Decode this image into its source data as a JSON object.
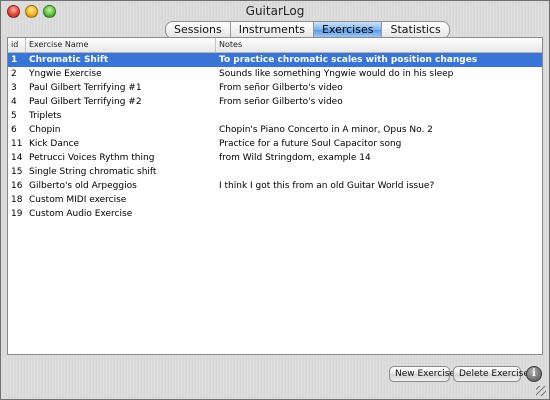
{
  "window": {
    "title": "GuitarLog"
  },
  "tabs": [
    {
      "label": "Sessions",
      "active": false
    },
    {
      "label": "Instruments",
      "active": false
    },
    {
      "label": "Exercises",
      "active": true
    },
    {
      "label": "Statistics",
      "active": false
    }
  ],
  "table": {
    "columns": [
      "id",
      "Exercise Name",
      "Notes"
    ],
    "rows": [
      {
        "id": "1",
        "name": "Chromatic Shift",
        "notes": "To practice chromatic scales with position changes",
        "selected": true
      },
      {
        "id": "2",
        "name": "Yngwie Exercise",
        "notes": "Sounds like something Yngwie would do in his sleep"
      },
      {
        "id": "3",
        "name": "Paul Gilbert Terrifying #1",
        "notes": "From señor Gilberto's video"
      },
      {
        "id": "4",
        "name": "Paul Gilbert Terrifying #2",
        "notes": "From señor Gilberto's video"
      },
      {
        "id": "5",
        "name": "Triplets",
        "notes": ""
      },
      {
        "id": "6",
        "name": "Chopin",
        "notes": "Chopin's Piano Concerto in A minor, Opus No. 2"
      },
      {
        "id": "11",
        "name": "Kick Dance",
        "notes": "Practice for a future Soul Capacitor song"
      },
      {
        "id": "14",
        "name": "Petrucci Voices Rythm thing",
        "notes": "from Wild Stringdom, example 14"
      },
      {
        "id": "15",
        "name": "Single String chromatic shift",
        "notes": ""
      },
      {
        "id": "16",
        "name": "Gilberto's old Arpeggios",
        "notes": "I think I got this from an old Guitar World issue?"
      },
      {
        "id": "18",
        "name": "Custom MIDI exercise",
        "notes": ""
      },
      {
        "id": "19",
        "name": "Custom Audio Exercise",
        "notes": ""
      }
    ]
  },
  "buttons": {
    "new": "New Exercise",
    "delete": "Delete Exercise",
    "info": "i"
  }
}
